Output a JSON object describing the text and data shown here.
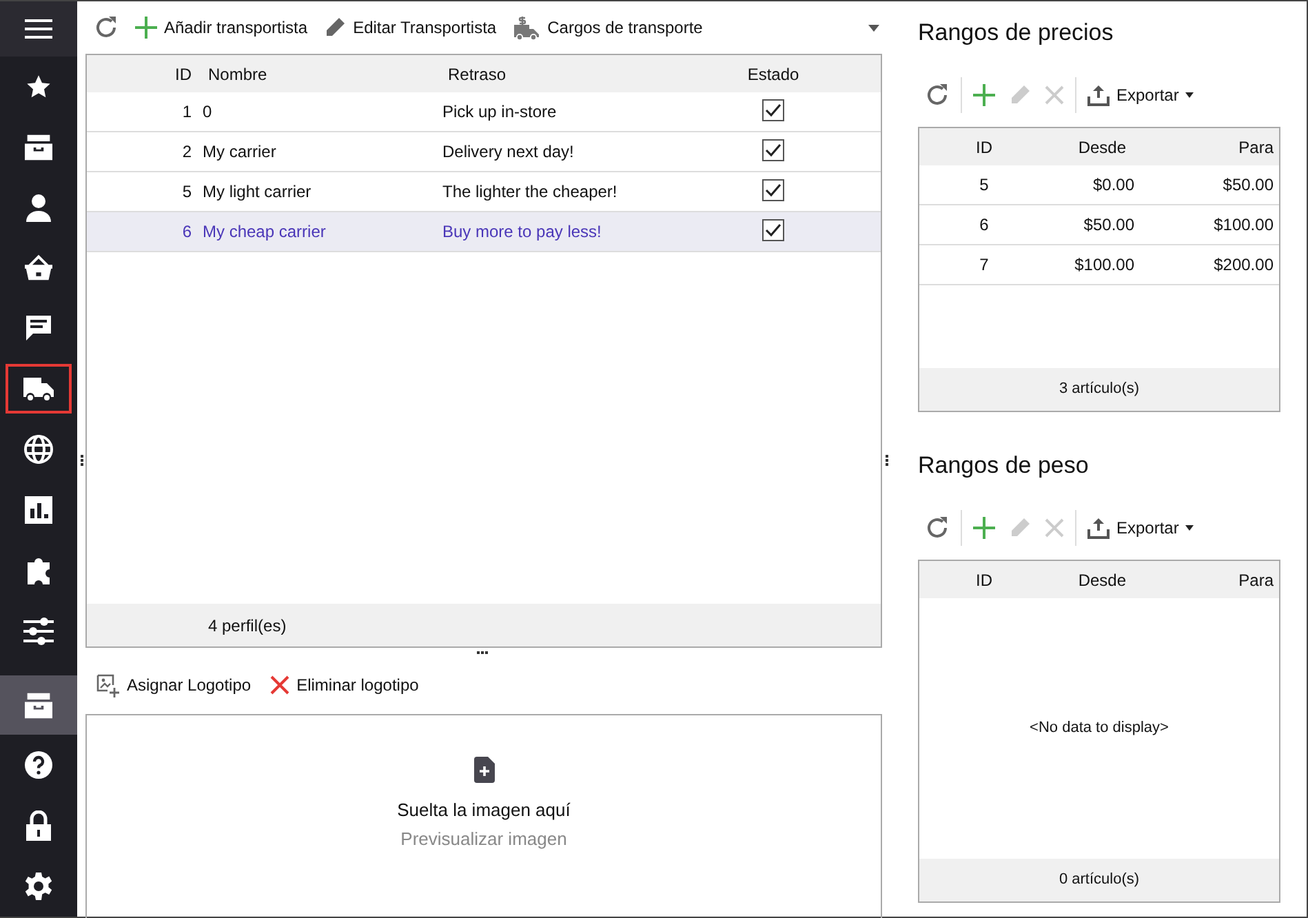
{
  "sidebar": {
    "top_items": [
      {
        "kind": "star",
        "selected": false,
        "highlighted": false
      },
      {
        "kind": "inbox",
        "selected": false,
        "highlighted": false
      },
      {
        "kind": "person",
        "selected": false,
        "highlighted": false
      },
      {
        "kind": "basket",
        "selected": false,
        "highlighted": false
      },
      {
        "kind": "chat",
        "selected": false,
        "highlighted": false
      },
      {
        "kind": "truck",
        "selected": true,
        "highlighted": false
      },
      {
        "kind": "globe",
        "selected": false,
        "highlighted": false
      },
      {
        "kind": "chart",
        "selected": false,
        "highlighted": false
      },
      {
        "kind": "puzzle",
        "selected": false,
        "highlighted": false
      },
      {
        "kind": "sliders",
        "selected": false,
        "highlighted": false
      }
    ],
    "bottom_items": [
      {
        "kind": "inbox",
        "selected": false,
        "highlighted": true
      },
      {
        "kind": "help",
        "selected": false,
        "highlighted": false
      },
      {
        "kind": "lock",
        "selected": false,
        "highlighted": false
      },
      {
        "kind": "gear",
        "selected": false,
        "highlighted": false
      }
    ]
  },
  "carriers": {
    "toolbar": [
      {
        "kind": "refresh"
      },
      {
        "kind": "add",
        "label": "Añadir transportista"
      },
      {
        "kind": "edit",
        "label": "Editar Transportista"
      },
      {
        "kind": "charges",
        "label": "Cargos de transporte"
      }
    ],
    "columns": [
      "ID",
      "Nombre",
      "Retraso",
      "Estado"
    ],
    "rows": [
      {
        "id": "1",
        "name": "0",
        "delay": "Pick up in-store",
        "enabled": true,
        "selected": false
      },
      {
        "id": "2",
        "name": "My carrier",
        "delay": "Delivery next day!",
        "enabled": true,
        "selected": false
      },
      {
        "id": "5",
        "name": "My light carrier",
        "delay": "The lighter the cheaper!",
        "enabled": true,
        "selected": false
      },
      {
        "id": "6",
        "name": "My cheap carrier",
        "delay": "Buy more to pay less!",
        "enabled": true,
        "selected": true
      }
    ],
    "footer": "4 perfil(es)"
  },
  "logo": {
    "toolbar": [
      {
        "kind": "assign",
        "label": "Asignar Logotipo"
      },
      {
        "kind": "delete",
        "label": "Eliminar logotipo"
      }
    ],
    "dropzone": {
      "title": "Suelta la imagen aquí",
      "subtitle": "Previsualizar imagen"
    }
  },
  "price_ranges": {
    "title": "Rangos de precios",
    "toolbar": [
      {
        "kind": "refresh",
        "disabled": false
      },
      {
        "kind": "add",
        "disabled": false
      },
      {
        "kind": "edit",
        "disabled": true
      },
      {
        "kind": "delete",
        "disabled": true
      },
      {
        "kind": "export",
        "label": "Exportar",
        "disabled": false
      }
    ],
    "columns": [
      "ID",
      "Desde",
      "Para"
    ],
    "rows": [
      {
        "id": "5",
        "from": "$0.00",
        "to": "$50.00"
      },
      {
        "id": "6",
        "from": "$50.00",
        "to": "$100.00"
      },
      {
        "id": "7",
        "from": "$100.00",
        "to": "$200.00"
      }
    ],
    "footer": "3 artículo(s)"
  },
  "weight_ranges": {
    "title": "Rangos de peso",
    "toolbar": [
      {
        "kind": "refresh",
        "disabled": false
      },
      {
        "kind": "add",
        "disabled": false
      },
      {
        "kind": "edit",
        "disabled": true
      },
      {
        "kind": "delete",
        "disabled": true
      },
      {
        "kind": "export",
        "label": "Exportar",
        "disabled": false
      }
    ],
    "columns": [
      "ID",
      "Desde",
      "Para"
    ],
    "empty_text": "<No data to display>",
    "footer": "0 artículo(s)"
  }
}
